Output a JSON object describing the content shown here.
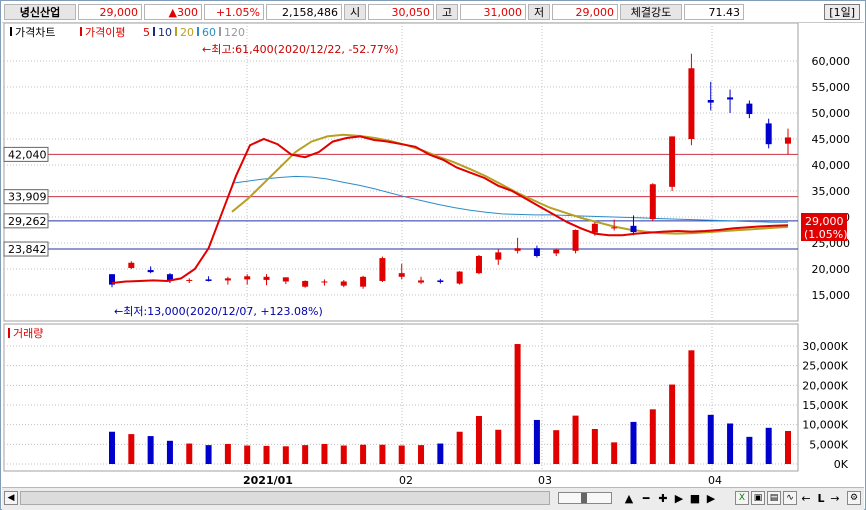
{
  "header": {
    "stock_name": "녕신산업",
    "price": "29,000",
    "change_mark": "▲",
    "change": "300",
    "change_rate": "+1.05%",
    "volume": "2,158,486",
    "open_label": "시",
    "open": "30,050",
    "high_label": "고",
    "high": "31,000",
    "low_label": "저",
    "low": "29,000",
    "strength_label": "체결강도",
    "strength": "71.43",
    "period_button": "[1일]"
  },
  "legend": {
    "price_chart": "가격차트",
    "ma_label": "가격이평",
    "ma5": "5",
    "ma10": "10",
    "ma20": "20",
    "ma60": "60",
    "ma120": "120"
  },
  "annotations": {
    "high_note": "←최고:61,400(2020/12/22, -52.77%)",
    "low_note": "←최저:13,000(2020/12/07, +123.08%)"
  },
  "price_axis_ticks": [
    "60,000",
    "55,000",
    "50,000",
    "45,000",
    "40,000",
    "35,000",
    "30,000",
    "25,000",
    "20,000",
    "15,000"
  ],
  "price_levels": [
    {
      "label": "42,040",
      "value": 42040,
      "color": "#cc3344"
    },
    {
      "label": "33,909",
      "value": 33909,
      "color": "#cc3344"
    },
    {
      "label": "29,262",
      "value": 29262,
      "color": "#2233aa"
    },
    {
      "label": "23,842",
      "value": 23842,
      "color": "#2233aa"
    }
  ],
  "current_price_tag": {
    "price": "29,000",
    "rate": "(1.05%)"
  },
  "volume_panel": {
    "title": "거래량",
    "ticks": [
      "30,000K",
      "25,000K",
      "20,000K",
      "15,000K",
      "10,000K",
      "5,000K",
      "0K"
    ]
  },
  "date_axis": [
    "2021/01",
    "02",
    "03",
    "04"
  ],
  "colors": {
    "up": "#e00000",
    "down": "#0000cc",
    "ma5": "#e00000",
    "ma20": "#b8a020",
    "ma60": "#2c8cc8",
    "ma10": "#1a2a7a",
    "grid": "#c0c0c0"
  },
  "chart_data": {
    "type": "candlestick",
    "title": "",
    "ylim": [
      12000,
      63000
    ],
    "volume_ylim": [
      0,
      33000
    ],
    "candles": [
      [
        19000,
        19000,
        16500,
        17000,
        8200
      ],
      [
        20200,
        21500,
        20000,
        21200,
        7600
      ],
      [
        19800,
        20500,
        19200,
        19400,
        7100
      ],
      [
        19000,
        19200,
        17300,
        17700,
        5900
      ],
      [
        17800,
        18200,
        17300,
        17900,
        5200
      ],
      [
        18000,
        18600,
        17600,
        17700,
        4800
      ],
      [
        17800,
        18500,
        17000,
        18200,
        5100
      ],
      [
        18000,
        19000,
        17000,
        18600,
        4700
      ],
      [
        17900,
        19000,
        16900,
        18500,
        4600
      ],
      [
        17600,
        18400,
        17100,
        18400,
        4500
      ],
      [
        16600,
        17800,
        16400,
        17700,
        4800
      ],
      [
        17400,
        18000,
        16800,
        17600,
        5100
      ],
      [
        16800,
        17900,
        16500,
        17600,
        4700
      ],
      [
        16600,
        18700,
        16200,
        18500,
        4900
      ],
      [
        17700,
        22400,
        17500,
        22100,
        4900
      ],
      [
        18500,
        21000,
        18000,
        19200,
        4700
      ],
      [
        17400,
        18500,
        17100,
        17800,
        4800
      ],
      [
        17800,
        18100,
        17200,
        17500,
        5200
      ],
      [
        17200,
        19600,
        17000,
        19500,
        8200
      ],
      [
        19200,
        22700,
        19000,
        22500,
        12200
      ],
      [
        21800,
        23800,
        20800,
        23200,
        8700
      ],
      [
        23500,
        26000,
        23000,
        24000,
        30500
      ],
      [
        24000,
        24500,
        22200,
        22500,
        11200
      ],
      [
        23000,
        23900,
        22500,
        23700,
        8600
      ],
      [
        23500,
        27600,
        23000,
        27500,
        12300
      ],
      [
        27000,
        29000,
        26400,
        28700,
        8900
      ],
      [
        28000,
        29500,
        27400,
        28000,
        5500
      ],
      [
        28300,
        30300,
        26500,
        27100,
        10700
      ],
      [
        29600,
        36500,
        29200,
        36300,
        13900
      ],
      [
        35800,
        45500,
        35000,
        45500,
        20200
      ],
      [
        45000,
        61400,
        43800,
        58600,
        28900
      ],
      [
        52500,
        56000,
        50500,
        52000,
        12500
      ],
      [
        53000,
        54500,
        50000,
        52600,
        10300
      ],
      [
        51800,
        52400,
        49000,
        49800,
        6900
      ],
      [
        48000,
        48900,
        43200,
        44000,
        9200
      ],
      [
        44100,
        47000,
        42000,
        45300,
        8400
      ]
    ],
    "ma5": [
      17300,
      17600,
      17700,
      17800,
      17700,
      18200,
      20000,
      24000,
      31000,
      38000,
      43800,
      45000,
      44000,
      42000,
      41500,
      42500,
      44500,
      45200,
      45500,
      44800,
      44500,
      44000,
      43500,
      42000,
      41000,
      39500,
      38500,
      37500,
      36000,
      35000,
      33500,
      32000,
      30500,
      29000,
      27800,
      26800,
      26500,
      26500,
      26800,
      27000,
      27200,
      27300,
      27200,
      27300,
      27500,
      27800,
      28000,
      28200,
      28300,
      28400
    ],
    "ma20": [
      31000,
      33500,
      36500,
      39500,
      42500,
      44500,
      45500,
      45800,
      45600,
      45200,
      44600,
      43800,
      42800,
      41600,
      40500,
      39200,
      37800,
      36200,
      34600,
      33200,
      31800,
      30800,
      29800,
      29000,
      28200,
      27600,
      27200,
      26900,
      26800,
      26900,
      27100,
      27300,
      27500,
      27700,
      27900,
      28100
    ],
    "ma60": [
      36500,
      36900,
      37300,
      37600,
      37800,
      37700,
      37300,
      36700,
      36100,
      35400,
      34600,
      33800,
      33100,
      32400,
      31800,
      31300,
      30900,
      30600,
      30500,
      30400,
      30400,
      30300,
      30200,
      30100,
      30000,
      29900,
      29800,
      29700,
      29600,
      29500,
      29400,
      29300,
      29200,
      29100,
      29000,
      29000
    ],
    "volume_hint": "bars in thousands of shares"
  }
}
